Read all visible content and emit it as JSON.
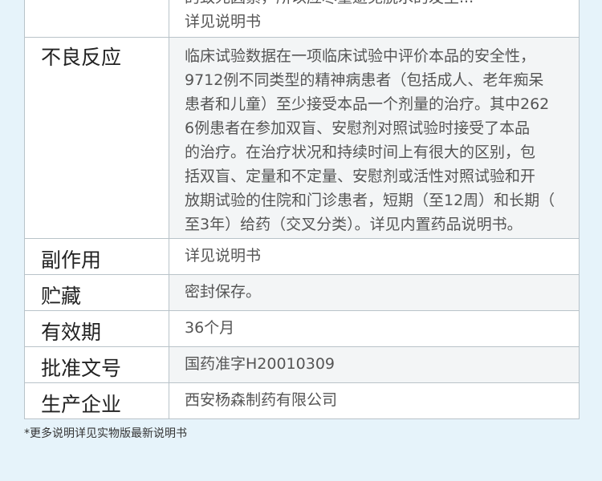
{
  "rows": [
    {
      "label": "",
      "lines": [
        "的致死因素，所以应尽量避免脱水的发生...",
        "详见说明书"
      ]
    },
    {
      "label": "不良反应",
      "lines": [
        "临床试验数据在一项临床试验中评价本品的安全性，",
        "9712例不同类型的精神病患者（包括成人、老年痴呆",
        "患者和儿童）至少接受本品一个剂量的治疗。其中262",
        "6例患者在参加双盲、安慰剂对照试验时接受了本品",
        "的治疗。在治疗状况和持续时间上有很大的区别，包",
        "括双盲、定量和不定量、安慰剂或活性对照试验和开",
        "放期试验的住院和门诊患者，短期（至12周）和长期（",
        "至3年）给药（交叉分类）。详见内置药品说明书。"
      ]
    },
    {
      "label": "副作用",
      "value": "详见说明书"
    },
    {
      "label": "贮藏",
      "value": "密封保存。"
    },
    {
      "label": "有效期",
      "value": "36个月"
    },
    {
      "label": "批准文号",
      "value": "国药准字H20010309"
    },
    {
      "label": "生产企业",
      "value": "西安杨森制药有限公司"
    }
  ],
  "footnote": "*更多说明详见实物版最新说明书"
}
